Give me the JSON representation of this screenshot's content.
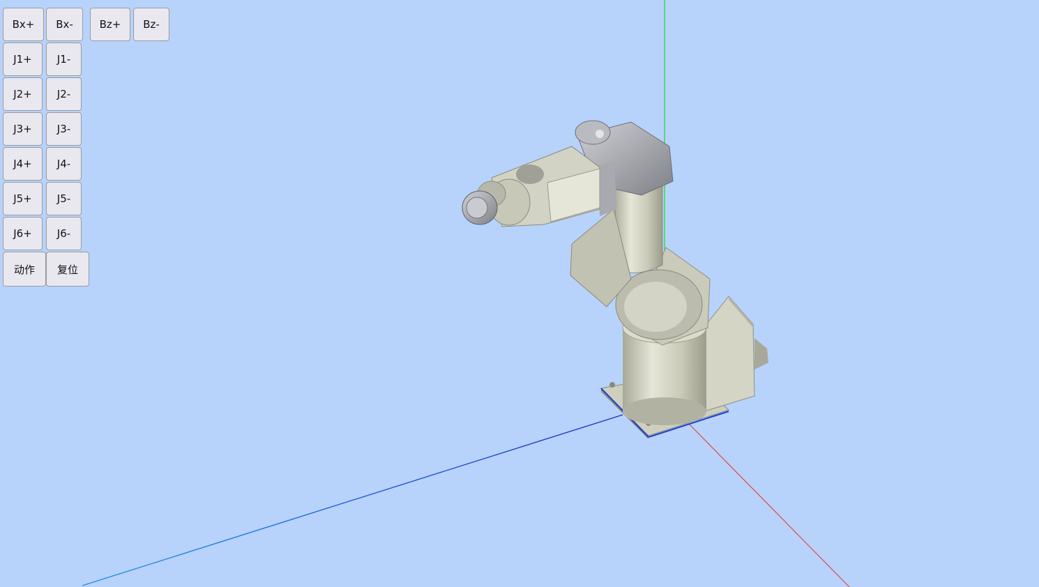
{
  "controls": {
    "bx_plus": "Bx+",
    "bx_minus": "Bx-",
    "bz_plus": "Bz+",
    "bz_minus": "Bz-",
    "j1_plus": "J1+",
    "j1_minus": "J1-",
    "j2_plus": "J2+",
    "j2_minus": "J2-",
    "j3_plus": "J3+",
    "j3_minus": "J3-",
    "j4_plus": "J4+",
    "j4_minus": "J4-",
    "j5_plus": "J5+",
    "j5_minus": "J5-",
    "j6_plus": "J6+",
    "j6_minus": "J6-",
    "action": "动作",
    "reset": "复位"
  },
  "scene": {
    "background_color": "#b7d3fb",
    "axis_colors": {
      "x": "#e04848",
      "y": "#35d83a",
      "z": "#1f3fd0"
    },
    "robot_color": "#cfcfbf"
  }
}
